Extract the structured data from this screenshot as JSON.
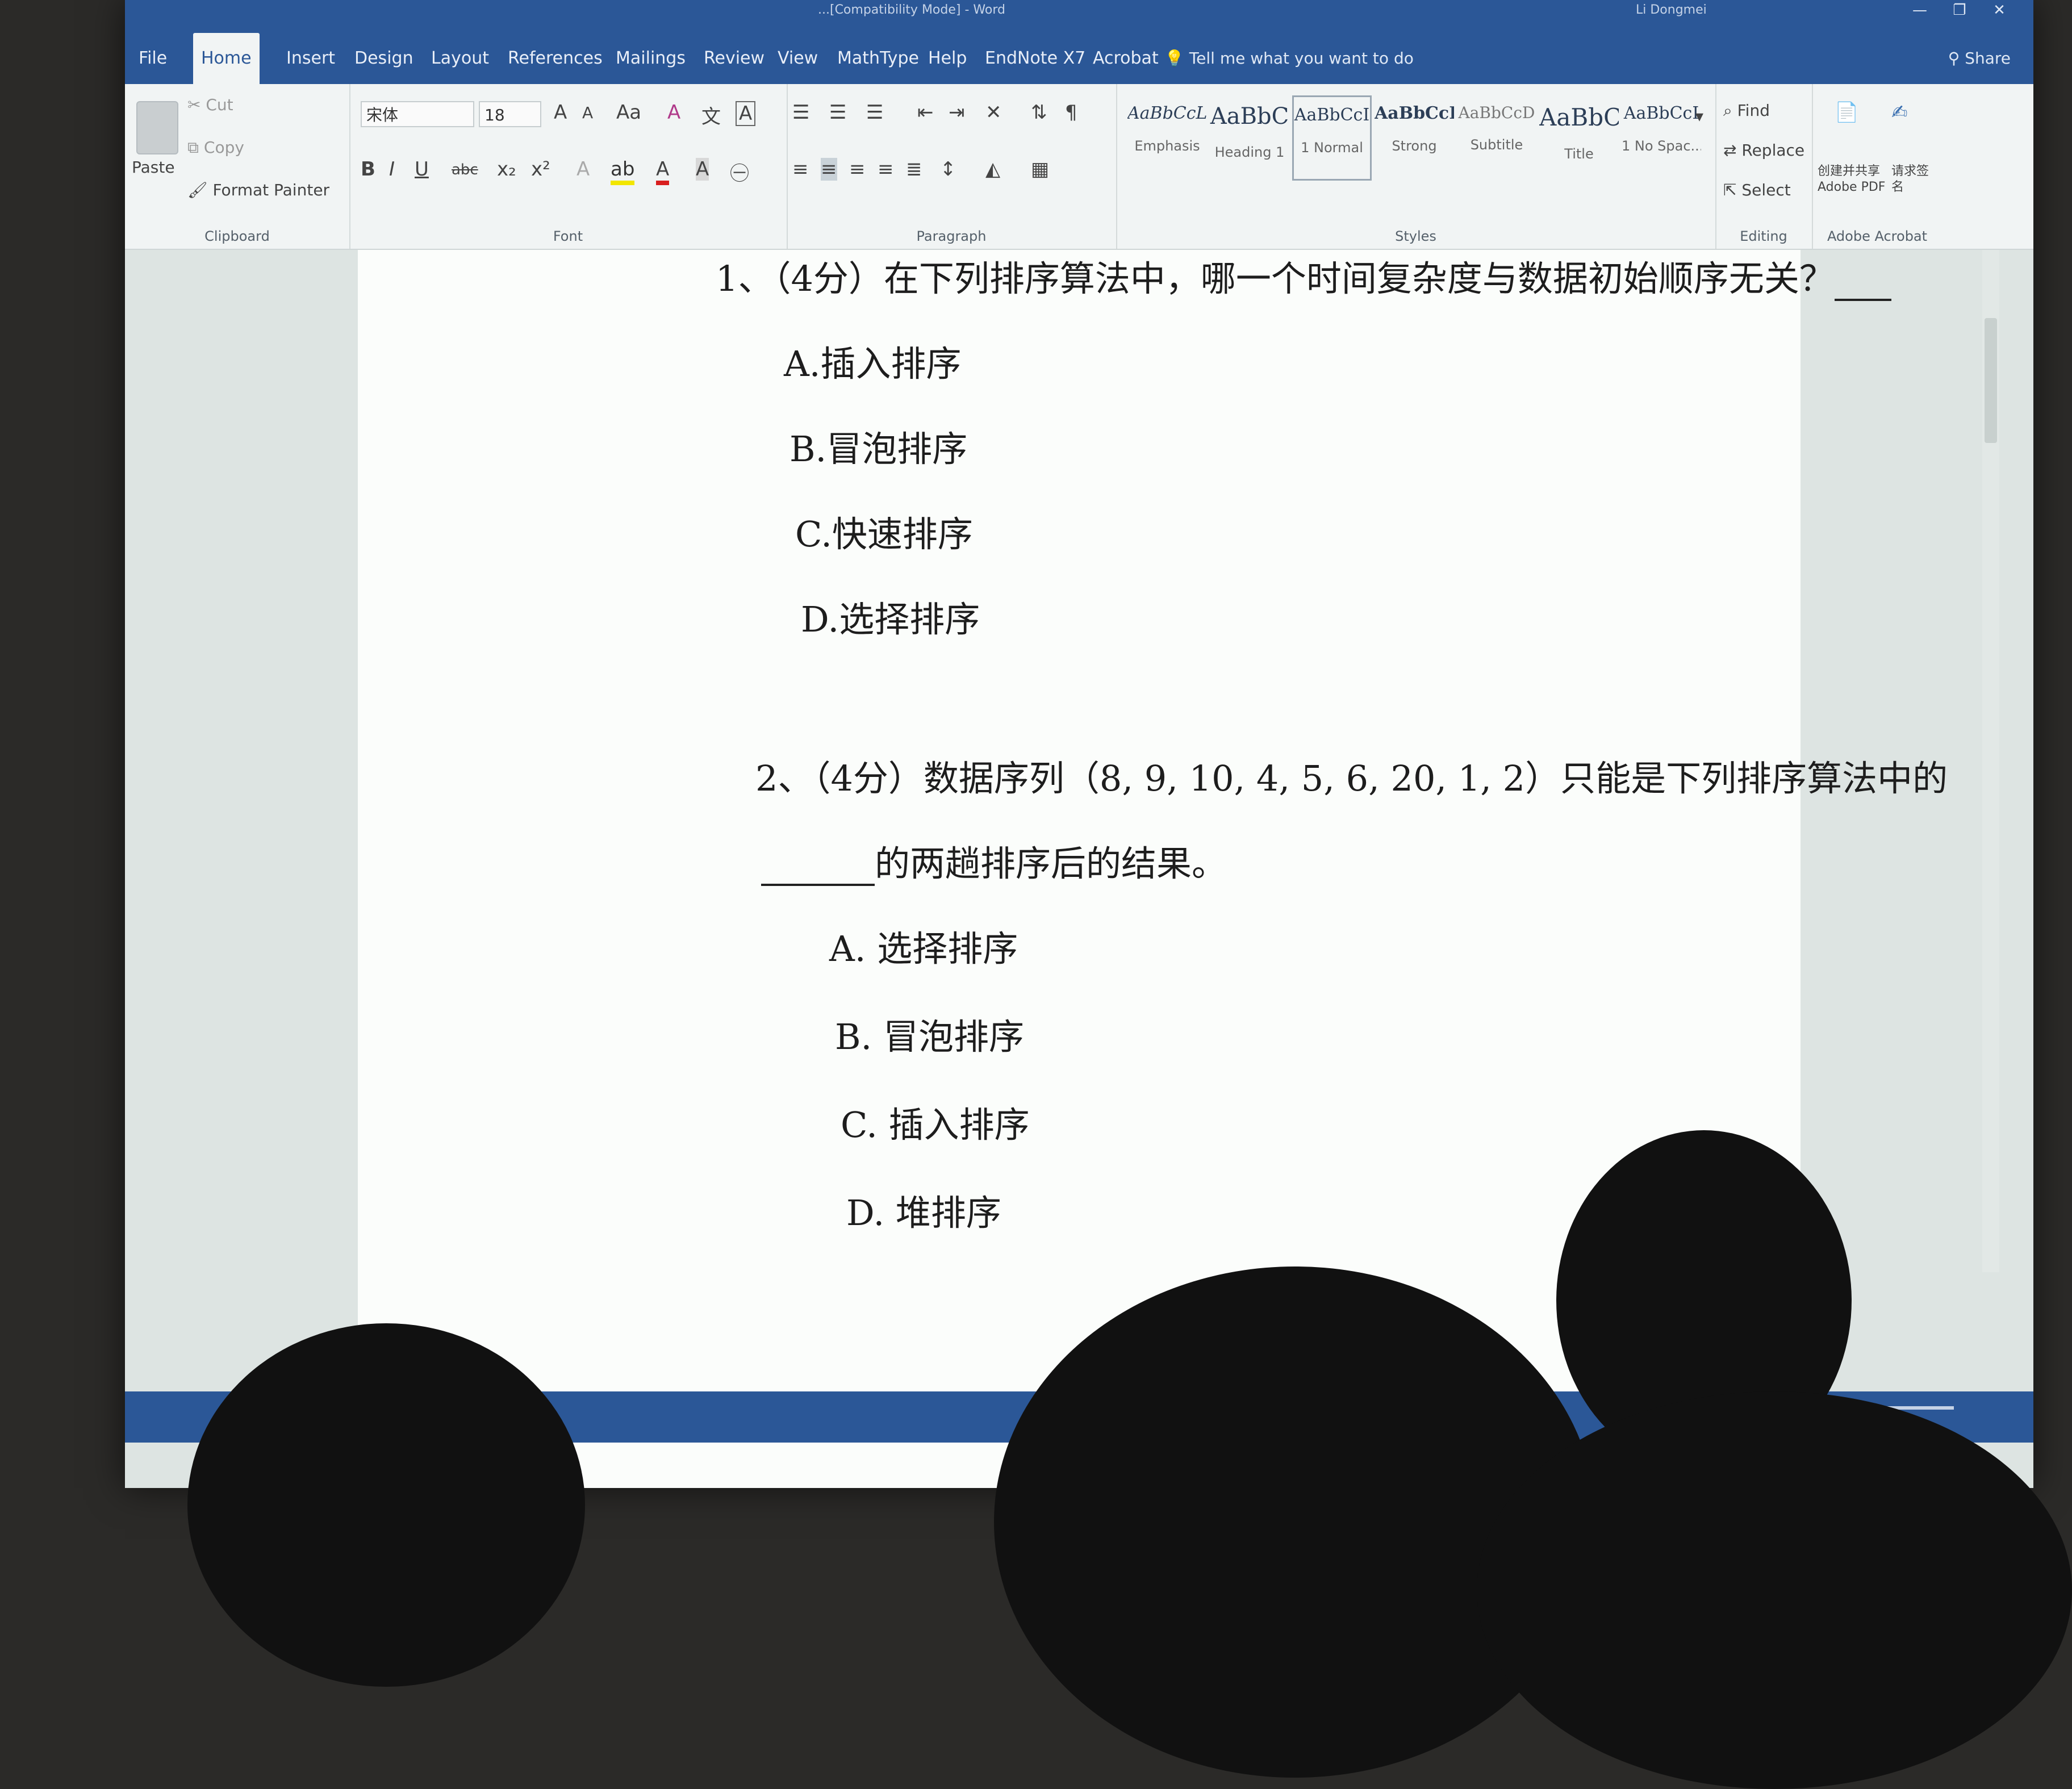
{
  "window": {
    "title": "...[Compatibility Mode] - Word",
    "user": "Li Dongmei",
    "controls": [
      "—",
      "❐",
      "✕"
    ]
  },
  "tabs": [
    "File",
    "Home",
    "Insert",
    "Design",
    "Layout",
    "References",
    "Mailings",
    "Review",
    "View",
    "MathType",
    "Help",
    "EndNote X7",
    "Acrobat"
  ],
  "tell_me": "Tell me what you want to do",
  "share": "Share",
  "ribbon": {
    "clipboard": {
      "paste": "Paste",
      "cut": "Cut",
      "copy": "Copy",
      "format_painter": "Format Painter",
      "label": "Clipboard"
    },
    "font": {
      "name": "宋体",
      "size": "18",
      "label": "Font"
    },
    "paragraph": {
      "label": "Paragraph"
    },
    "styles": {
      "label": "Styles",
      "items": [
        {
          "sample": "AaBbCcL",
          "name": "Emphasis"
        },
        {
          "sample": "AaBbC",
          "name": "Heading 1"
        },
        {
          "sample": "AaBbCcI",
          "name": "1 Normal"
        },
        {
          "sample": "AaBbCcI",
          "name": "Strong"
        },
        {
          "sample": "AaBbCcD",
          "name": "Subtitle"
        },
        {
          "sample": "AaBbC",
          "name": "Title"
        },
        {
          "sample": "AaBbCcI",
          "name": "1 No Spac..."
        }
      ]
    },
    "editing": {
      "find": "Find",
      "replace": "Replace",
      "select": "Select",
      "label": "Editing"
    },
    "acrobat": {
      "create_share": "创建并共享 Adobe PDF",
      "request_sign": "请求签名",
      "label": "Adobe Acrobat"
    }
  },
  "document": {
    "q1": {
      "text": "1、（4分）在下列排序算法中，哪一个时间复杂度与数据初始顺序无关？",
      "options": [
        "A.插入排序",
        "B.冒泡排序",
        "C.快速排序",
        "D.选择排序"
      ]
    },
    "q2": {
      "line1": "2、（4分）数据序列（8, 9, 10, 4, 5, 6, 20, 1, 2）只能是下列排序算法中的",
      "line2": "的两趟排序后的结果。",
      "options": [
        "A. 选择排序",
        "B. 冒泡排序",
        "C. 插入排序",
        "D. 堆排序"
      ]
    }
  }
}
